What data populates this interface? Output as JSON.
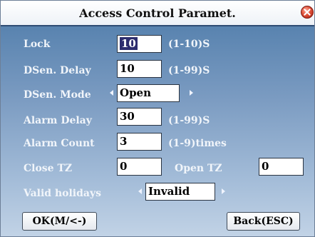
{
  "window": {
    "title": "Access Control Paramet."
  },
  "fields": {
    "lock": {
      "label": "Lock",
      "value": "10",
      "unit": "(1-10)S"
    },
    "dsen_delay": {
      "label": "DSen. Delay",
      "value": "10",
      "unit": "(1-99)S"
    },
    "dsen_mode": {
      "label": "DSen. Mode",
      "value": "Open"
    },
    "alarm_delay": {
      "label": "Alarm Delay",
      "value": "30",
      "unit": "(1-99)S"
    },
    "alarm_count": {
      "label": "Alarm Count",
      "value": "3",
      "unit": "(1-9)times"
    },
    "close_tz": {
      "label": "Close TZ",
      "value": "0"
    },
    "open_tz": {
      "label": "Open TZ",
      "value": "0"
    },
    "valid_holidays": {
      "label": "Valid holidays",
      "value": "Invalid"
    }
  },
  "buttons": {
    "ok": "OK(M/<-)",
    "back": "Back(ESC)"
  },
  "colors": {
    "title_bg": "#ffffff",
    "panel_top": "#4c77a5",
    "panel_bottom": "#c2d3e6",
    "close_button": "#e0523a"
  }
}
